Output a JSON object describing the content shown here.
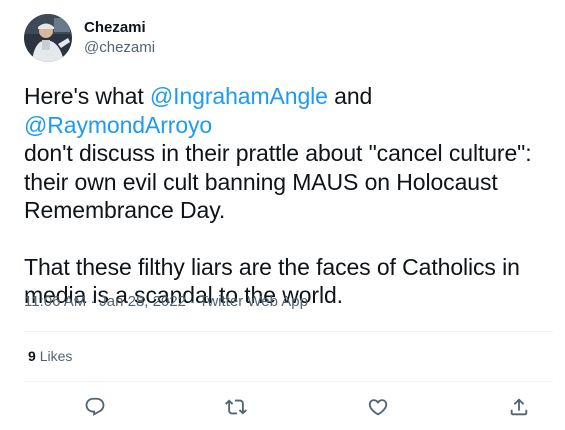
{
  "author": {
    "display_name": "Chezami",
    "handle": "@chezami"
  },
  "tweet": {
    "para1": [
      {
        "text": "Here's what ",
        "type": "text"
      },
      {
        "text": "@IngrahamAngle",
        "type": "mention"
      },
      {
        "text": " and ",
        "type": "text"
      },
      {
        "text": "@RaymondArroyo",
        "type": "mention"
      },
      {
        "text": "\ndon't discuss in their prattle about \"cancel culture\":\ntheir own evil cult banning MAUS on Holocaust\nRemembrance Day.",
        "type": "text"
      }
    ],
    "para2": "That these filthy liars are the faces of Catholics in\nmedia is a scandal to the world."
  },
  "meta": {
    "time": "11:06 AM",
    "separator": "·",
    "date": "Jan 28, 2022",
    "source": "Twitter Web App"
  },
  "stats": {
    "likes_count": "9",
    "likes_label": "Likes"
  },
  "actions": {
    "reply_icon": "reply-icon",
    "retweet_icon": "retweet-icon",
    "like_icon": "heart-icon",
    "share_icon": "share-icon"
  },
  "colors": {
    "mention": "#1d9bf0",
    "text": "#0f1419",
    "secondary": "#536471",
    "divider": "#eff3f4"
  }
}
